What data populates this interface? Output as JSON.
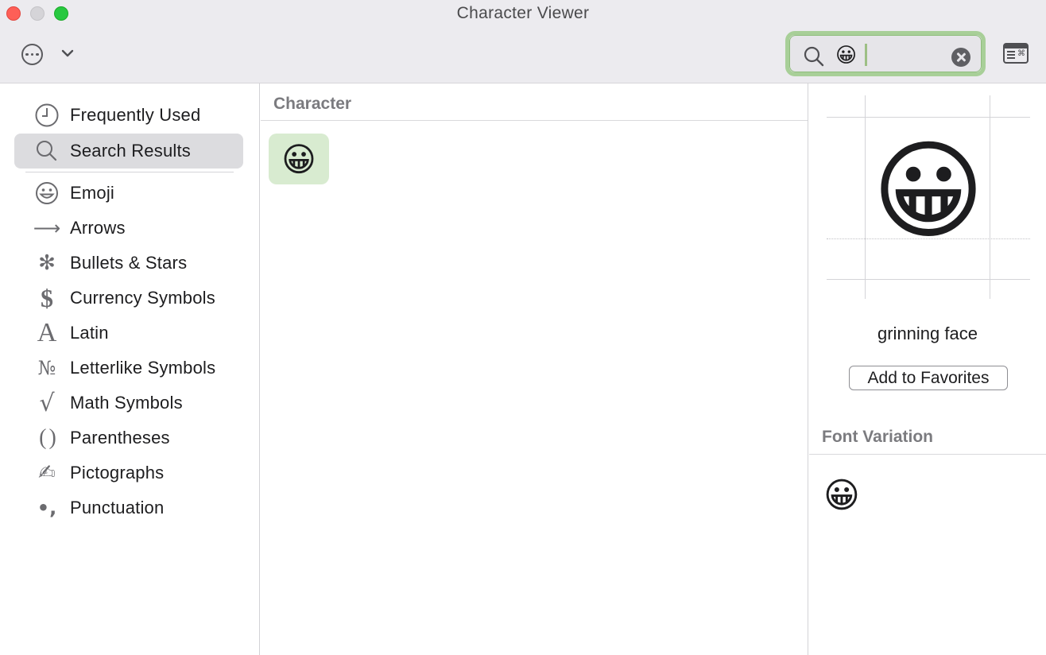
{
  "window": {
    "title": "Character Viewer"
  },
  "toolbar": {
    "search_value": "😀",
    "more_icon": "ellipsis-circle-icon",
    "chevron_icon": "chevron-down-icon",
    "clear_icon": "clear-icon",
    "keyboard_icon": "keyboard-viewer-icon",
    "search_accent": "#a8cf98"
  },
  "sidebar": {
    "items": [
      {
        "label": "Frequently Used",
        "icon": "clock-icon",
        "glyph": ""
      },
      {
        "label": "Search Results",
        "icon": "search-icon",
        "glyph": "",
        "selected": true
      },
      {
        "label": "Emoji",
        "icon": "smiley-icon",
        "glyph": "☺"
      },
      {
        "label": "Arrows",
        "icon": "arrow-icon",
        "glyph": "⟶"
      },
      {
        "label": "Bullets & Stars",
        "icon": "asterisk-icon",
        "glyph": "✻"
      },
      {
        "label": "Currency Symbols",
        "icon": "dollar-icon",
        "glyph": "$"
      },
      {
        "label": "Latin",
        "icon": "latin-a-icon",
        "glyph": "A"
      },
      {
        "label": "Letterlike Symbols",
        "icon": "numero-icon",
        "glyph": "№"
      },
      {
        "label": "Math Symbols",
        "icon": "square-root-icon",
        "glyph": "√"
      },
      {
        "label": "Parentheses",
        "icon": "parentheses-icon",
        "glyph": "( )"
      },
      {
        "label": "Pictographs",
        "icon": "writing-hand-icon",
        "glyph": "✍"
      },
      {
        "label": "Punctuation",
        "icon": "punctuation-icon",
        "glyph": "•,"
      }
    ]
  },
  "center": {
    "header": "Character",
    "results": [
      "😀"
    ]
  },
  "detail": {
    "preview_char": "😀",
    "name": "grinning face",
    "add_button": "Add to Favorites",
    "variation_header": "Font Variation",
    "variations": [
      "😀"
    ]
  }
}
